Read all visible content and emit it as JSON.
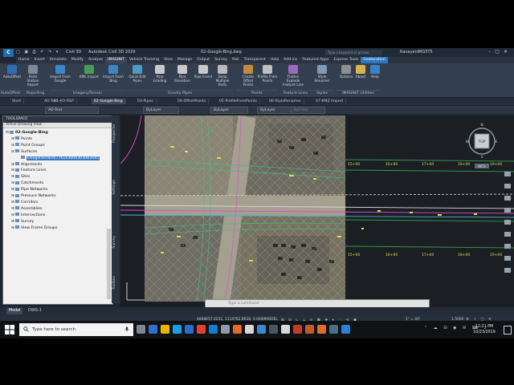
{
  "title_bar": {
    "app_name": "Autodesk Civil 3D 2020",
    "document": "02-Google-Bing.dwg",
    "search_placeholder": "Type a keyword or phrase",
    "user": "RavayenIMG5T5",
    "workspace": "Civil 3D",
    "logo_text": "C"
  },
  "ribbon_tabs": [
    "Home",
    "Insert",
    "Annotate",
    "Modify",
    "Analyze",
    "IMAGINiT",
    "Vehicle Tracking",
    "View",
    "Manage",
    "Output",
    "Survey",
    "Rail",
    "Transparent",
    "Help",
    "Add-ins",
    "Featured Apps",
    "Express Tools",
    "Geolocation"
  ],
  "ribbon_active_tab": "IMAGINiT",
  "ribbon_context_tab": "Geolocation",
  "ribbon_buttons": [
    {
      "label": "AutoOffset",
      "color": "#2f6db3"
    },
    {
      "label": "Point Station Report",
      "color": "#7a8a9b"
    },
    {
      "label": "Import From Google",
      "color": "#3d86c6"
    },
    {
      "label": "KML Import",
      "color": "#4a9a58"
    },
    {
      "label": "Import From Bing",
      "color": "#3d86c6"
    },
    {
      "label": "Quick Edit Pipes",
      "color": "#4c9ac7"
    },
    {
      "label": "Pipe Grading",
      "color": "#c9c9c9"
    },
    {
      "label": "Pipe Elevation",
      "color": "#c9c9c9"
    },
    {
      "label": "Pipe Invert",
      "color": "#c9c9c9"
    },
    {
      "label": "Swap Multiple Parts",
      "color": "#b9b9b9"
    },
    {
      "label": "Create Offset Points",
      "color": "#c48b3f"
    },
    {
      "label": "Profile From Points",
      "color": "#c0c0c0"
    },
    {
      "label": "Flatten Explode Feature Line",
      "color": "#9a6ac0"
    },
    {
      "label": "Style Renamer",
      "color": "#7e9bb8"
    },
    {
      "label": "Options",
      "color": "#8f8f8f"
    },
    {
      "label": "About",
      "color": "#d8b44a"
    },
    {
      "label": "Help",
      "color": "#3c82c8"
    }
  ],
  "ribbon_panels": [
    "AutoOffset",
    "Reporting",
    "Imagery/Terrain",
    "Gravity Pipes",
    "Points",
    "Feature Lines",
    "Styles",
    "IMAGINiT Utilities"
  ],
  "file_tabs": [
    "Start",
    "AO-Text",
    "01-AO-RSP",
    "02-Google-Bing",
    "03-Pipes",
    "04-OffsetPoints",
    "05-ProfileFromPoints",
    "06-StyleRenamer",
    "07-KMZ Import"
  ],
  "file_tab_active": "02-Google-Bing",
  "properties_bar": {
    "layer": "AO-Text",
    "color": "ByLayer",
    "linetype": "ByLayer",
    "lineweight": "ByLayer",
    "plotstyle": "ByColor"
  },
  "toolspace": {
    "title": "TOOLSPACE",
    "view": "Active Drawing View",
    "tree": [
      {
        "label": "02-Google-Bing",
        "level": 0,
        "bold": true
      },
      {
        "label": "Points",
        "level": 1
      },
      {
        "label": "Point Groups",
        "level": 1
      },
      {
        "label": "Surfaces",
        "level": 1
      },
      {
        "label": "GoogleTerrain6776143000303083045",
        "level": 2,
        "selected": true
      },
      {
        "label": "Alignments",
        "level": 1
      },
      {
        "label": "Feature Lines",
        "level": 1
      },
      {
        "label": "Sites",
        "level": 1
      },
      {
        "label": "Catchments",
        "level": 1
      },
      {
        "label": "Pipe Networks",
        "level": 1
      },
      {
        "label": "Pressure Networks",
        "level": 1
      },
      {
        "label": "Corridors",
        "level": 1
      },
      {
        "label": "Assemblies",
        "level": 1
      },
      {
        "label": "Intersections",
        "level": 1
      },
      {
        "label": "Survey",
        "level": 1
      },
      {
        "label": "View Frame Groups",
        "level": 1
      }
    ]
  },
  "side_palettes": [
    "Prospector",
    "Settings",
    "Survey",
    "Toolbox"
  ],
  "viewport": {
    "station_labels": [
      "15+00",
      "16+00",
      "17+00",
      "18+00",
      "19+00",
      "15+00",
      "16+00",
      "17+00",
      "18+00",
      "19+00"
    ],
    "viewcube_face": "TOP",
    "compass": [
      "N",
      "E",
      "S",
      "W"
    ],
    "wcs": "WCS"
  },
  "command_line_placeholder": "Type a command",
  "layout_tabs": [
    "Model",
    "DWG-1"
  ],
  "layout_active": "Model",
  "status_bar": {
    "coordinates": "4868657.6231, 1114762.8628, 0.0000",
    "space": "MODEL",
    "scale": "1\" = 40'",
    "value": "1.5000"
  },
  "taskbar": {
    "search_placeholder": "Type here to search",
    "time": "12:21 PM",
    "date": "10/23/2019",
    "app_colors": [
      "#7e8790",
      "#2f6fd0",
      "#f0b400",
      "#1aa0e8",
      "#2e6bd0",
      "#e44134",
      "#0f7ecf",
      "#8a9aa8",
      "#e36a2d",
      "#d8d8d8",
      "#3a88d4",
      "#4a5560",
      "#d9d9d9",
      "#c33c2a",
      "#c75a2c",
      "#e06b2c",
      "#4d6d8c",
      "#2b7fd4"
    ]
  }
}
